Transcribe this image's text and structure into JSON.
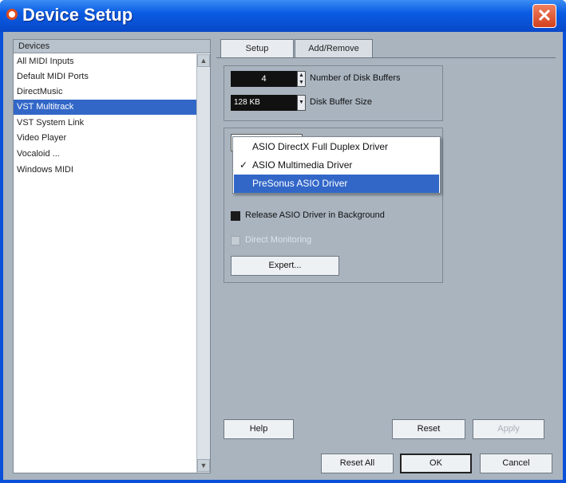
{
  "window": {
    "title": "Device Setup",
    "close_glyph": "✕"
  },
  "devices": {
    "header": "Devices",
    "items": [
      {
        "label": "All MIDI Inputs"
      },
      {
        "label": "Default MIDI Ports"
      },
      {
        "label": "DirectMusic"
      },
      {
        "label": "VST Multitrack",
        "selected": true
      },
      {
        "label": "VST System Link"
      },
      {
        "label": "Video Player"
      },
      {
        "label": "Vocaloid ..."
      },
      {
        "label": "Windows MIDI"
      }
    ]
  },
  "tabs": [
    {
      "label": "Setup",
      "active": true
    },
    {
      "label": "Add/Remove",
      "active": false
    }
  ],
  "setup": {
    "disk_buffers_value": "4",
    "disk_buffers_label": "Number of Disk Buffers",
    "buffer_size_value": "128 KB",
    "buffer_size_label": "Disk Buffer Size"
  },
  "driver_popup": {
    "options": [
      {
        "label": "ASIO DirectX Full Duplex Driver",
        "checked": false,
        "highlighted": false
      },
      {
        "label": "ASIO Multimedia Driver",
        "checked": true,
        "highlighted": false
      },
      {
        "label": "PreSonus ASIO Driver",
        "checked": false,
        "highlighted": true
      }
    ],
    "check_glyph": "✓"
  },
  "options": {
    "release_driver": {
      "label": "Release ASIO Driver in Background",
      "checked": true
    },
    "direct_monitoring": {
      "label": "Direct Monitoring",
      "enabled": false
    }
  },
  "buttons": {
    "expert": "Expert...",
    "help": "Help",
    "reset": "Reset",
    "apply": "Apply",
    "reset_all": "Reset All",
    "ok": "OK",
    "cancel": "Cancel"
  },
  "icons": [
    "app-logo-icon",
    "close-icon",
    "spin-up-down-icon",
    "dropdown-arrow-icon",
    "checkmark-icon",
    "scroll-up-icon",
    "scroll-down-icon"
  ],
  "colors": {
    "titlebar": "#0a5ce4",
    "client_bg": "#a9b4bf",
    "selection": "#3267c8",
    "close_button": "#d2401c"
  }
}
